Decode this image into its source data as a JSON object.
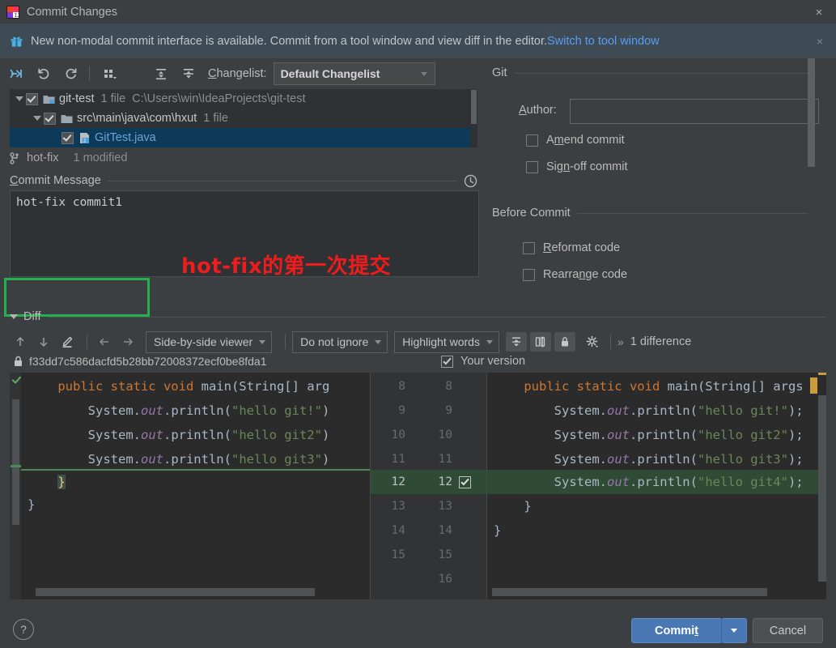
{
  "window": {
    "title": "Commit Changes",
    "app_icon": "intellij-idea-icon",
    "close_label": "×"
  },
  "notification": {
    "icon": "gift-icon",
    "message": "New non-modal commit interface is available. Commit from a tool window and view diff in the editor.",
    "link_label": "Switch to tool window",
    "close_label": "×"
  },
  "changelist_toolbar": {
    "buttons": [
      {
        "name": "rollback-icon",
        "tooltip": "Revert"
      },
      {
        "name": "undo-icon",
        "tooltip": "Undo"
      },
      {
        "name": "refresh-icon",
        "tooltip": "Refresh"
      },
      {
        "name": "group-by-icon",
        "tooltip": "Group By"
      },
      {
        "name": "expand-all-icon",
        "tooltip": "Expand All"
      },
      {
        "name": "collapse-all-icon",
        "tooltip": "Collapse All"
      }
    ],
    "changelist_label": "Changelist:",
    "changelist_value": "Default Changelist"
  },
  "file_tree": [
    {
      "indent": 0,
      "expander": "expanded",
      "checked": true,
      "icon": "module-folder-icon",
      "name": "git-test",
      "count": "1 file",
      "path": "C:\\Users\\win\\IdeaProjects\\git-test",
      "selected": false
    },
    {
      "indent": 1,
      "expander": "expanded",
      "checked": true,
      "icon": "folder-icon",
      "name": "src\\main\\java\\com\\hxut",
      "count": "1 file",
      "path": "",
      "selected": false
    },
    {
      "indent": 2,
      "expander": "none",
      "checked": true,
      "icon": "java-file-icon",
      "name": "GitTest.java",
      "count": "",
      "path": "",
      "selected": true
    }
  ],
  "branch_row": {
    "icon": "branch-icon",
    "branch": "hot-fix",
    "modified": "1 modified"
  },
  "commit_message": {
    "label": "Commit Message",
    "label_mnemonic": "C",
    "value": "hot-fix commit1",
    "history_icon": "clock-history-icon"
  },
  "annotations": {
    "chinese_note": "hot-fix的第一次提交",
    "note_color": "#ee1c1c",
    "box_color": "#22b14c"
  },
  "git_panel": {
    "group_title": "Git",
    "author_label": "Author:",
    "author_mnemonic": "A",
    "author_value": "",
    "checkboxes": [
      {
        "label": "Amend commit",
        "mnemonic": "m",
        "checked": false
      },
      {
        "label": "Sign-off commit",
        "mnemonic": "n",
        "checked": false
      }
    ]
  },
  "before_commit_panel": {
    "group_title": "Before Commit",
    "checkboxes": [
      {
        "label": "Reformat code",
        "mnemonic": "R",
        "checked": false
      },
      {
        "label": "Rearrange code",
        "mnemonic": "n",
        "checked": false
      }
    ]
  },
  "diff": {
    "section_title": "Diff",
    "nav_buttons": [
      {
        "name": "prev-difference-icon"
      },
      {
        "name": "next-difference-icon"
      },
      {
        "name": "edit-source-icon"
      },
      {
        "name": "accept-left-icon"
      },
      {
        "name": "accept-right-icon"
      }
    ],
    "viewer_mode": "Side-by-side viewer",
    "whitespace_mode": "Do not ignore",
    "highlight_mode": "Highlight words",
    "toggles": [
      {
        "name": "collapse-unchanged-icon",
        "active": true
      },
      {
        "name": "synchronize-scroll-icon",
        "active": true
      },
      {
        "name": "read-only-lock-icon",
        "active": true
      },
      {
        "name": "diff-settings-gear-icon",
        "active": false
      }
    ],
    "overflow_label": "»",
    "difference_count": "1 difference",
    "left_header": {
      "lock_icon": "lock-icon",
      "revision": "f33dd7c586dacfd5b28bb72008372ecf0be8fda1"
    },
    "right_header": {
      "checked": true,
      "label": "Your version"
    },
    "left_lines": [
      {
        "num": "8",
        "segments": [
          {
            "t": "    ",
            "c": "pl"
          },
          {
            "t": "public static void ",
            "c": "kw"
          },
          {
            "t": "main",
            "c": "mth"
          },
          {
            "t": "(String[] arg",
            "c": "pl"
          }
        ]
      },
      {
        "num": "9",
        "segments": [
          {
            "t": "        System.",
            "c": "pl"
          },
          {
            "t": "out",
            "c": "fld"
          },
          {
            "t": ".println(",
            "c": "pl"
          },
          {
            "t": "\"hello git!\"",
            "c": "str"
          },
          {
            "t": ")",
            "c": "pl"
          }
        ]
      },
      {
        "num": "10",
        "segments": [
          {
            "t": "        System.",
            "c": "pl"
          },
          {
            "t": "out",
            "c": "fld"
          },
          {
            "t": ".println(",
            "c": "pl"
          },
          {
            "t": "\"hello git2\"",
            "c": "str"
          },
          {
            "t": ")",
            "c": "pl"
          }
        ]
      },
      {
        "num": "11",
        "segments": [
          {
            "t": "        System.",
            "c": "pl"
          },
          {
            "t": "out",
            "c": "fld"
          },
          {
            "t": ".println(",
            "c": "pl"
          },
          {
            "t": "\"hello git3\"",
            "c": "str"
          },
          {
            "t": ")",
            "c": "pl"
          }
        ]
      },
      {
        "num": "12",
        "segments": [
          {
            "t": "    ",
            "c": "pl"
          },
          {
            "t": "}",
            "c": "brace"
          }
        ]
      },
      {
        "num": "13",
        "segments": [
          {
            "t": "}",
            "c": "pl"
          }
        ]
      },
      {
        "num": "14",
        "segments": []
      },
      {
        "num": "15",
        "segments": []
      }
    ],
    "right_lines": [
      {
        "num": "8",
        "added": false,
        "segments": [
          {
            "t": "    ",
            "c": "pl"
          },
          {
            "t": "public static void ",
            "c": "kw"
          },
          {
            "t": "main",
            "c": "mth"
          },
          {
            "t": "(String[] args",
            "c": "pl"
          }
        ]
      },
      {
        "num": "9",
        "added": false,
        "segments": [
          {
            "t": "        System.",
            "c": "pl"
          },
          {
            "t": "out",
            "c": "fld"
          },
          {
            "t": ".println(",
            "c": "pl"
          },
          {
            "t": "\"hello git!\"",
            "c": "str"
          },
          {
            "t": ");",
            "c": "pl"
          }
        ]
      },
      {
        "num": "10",
        "added": false,
        "segments": [
          {
            "t": "        System.",
            "c": "pl"
          },
          {
            "t": "out",
            "c": "fld"
          },
          {
            "t": ".println(",
            "c": "pl"
          },
          {
            "t": "\"hello git2\"",
            "c": "str"
          },
          {
            "t": ");",
            "c": "pl"
          }
        ]
      },
      {
        "num": "11",
        "added": false,
        "segments": [
          {
            "t": "        System.",
            "c": "pl"
          },
          {
            "t": "out",
            "c": "fld"
          },
          {
            "t": ".println(",
            "c": "pl"
          },
          {
            "t": "\"hello git3\"",
            "c": "str"
          },
          {
            "t": ");",
            "c": "pl"
          }
        ]
      },
      {
        "num": "12",
        "added": true,
        "segments": [
          {
            "t": "        System.",
            "c": "pl"
          },
          {
            "t": "out",
            "c": "fld"
          },
          {
            "t": ".println(",
            "c": "pl"
          },
          {
            "t": "\"hello git4\"",
            "c": "str"
          },
          {
            "t": ");",
            "c": "pl"
          }
        ]
      },
      {
        "num": "13",
        "added": false,
        "segments": [
          {
            "t": "    ",
            "c": "pl"
          },
          {
            "t": "}",
            "c": "pl"
          }
        ]
      },
      {
        "num": "14",
        "added": false,
        "segments": [
          {
            "t": "}",
            "c": "pl"
          }
        ]
      },
      {
        "num": "15",
        "added": false,
        "segments": []
      },
      {
        "num": "16",
        "added": false,
        "segments": []
      }
    ]
  },
  "footer": {
    "help_label": "?",
    "commit_label": "Commit",
    "commit_mnemonic": "t",
    "cancel_label": "Cancel",
    "commit_color": "#4a78b4"
  }
}
